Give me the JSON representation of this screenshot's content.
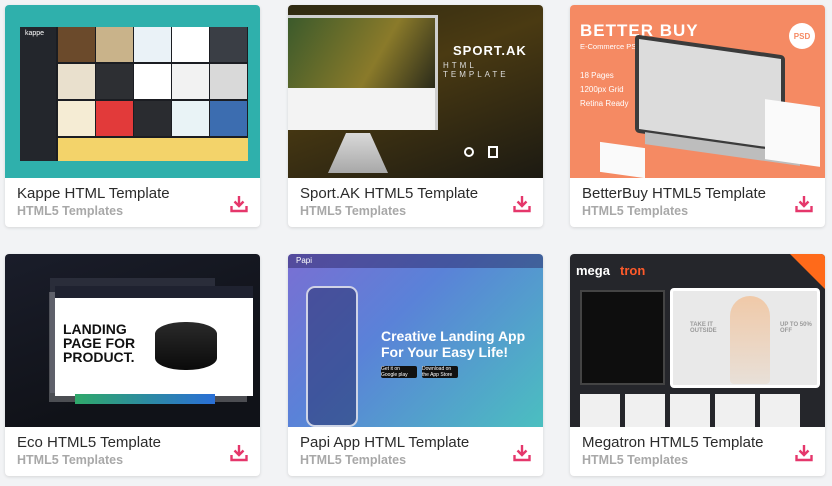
{
  "cards": [
    {
      "title": "Kappe HTML Template",
      "category": "HTML5 Templates",
      "thumb": {
        "brand": "kappe"
      }
    },
    {
      "title": "Sport.AK HTML5 Template",
      "category": "HTML5 Templates",
      "thumb": {
        "brand": "SPORT.AK",
        "subtitle": "HTML TEMPLATE"
      }
    },
    {
      "title": "BetterBuy HTML5 Template",
      "category": "HTML5 Templates",
      "thumb": {
        "brand": "BETTER BUY",
        "subtitle": "E-Commerce PSD UI Kit",
        "features": [
          "18 Pages",
          "1200px Grid",
          "Retina Ready"
        ],
        "badge": "PSD"
      }
    },
    {
      "title": "Eco HTML5 Template",
      "category": "HTML5 Templates",
      "thumb": {
        "headline": "LANDING PAGE FOR PRODUCT."
      }
    },
    {
      "title": "Papi App HTML Template",
      "category": "HTML5 Templates",
      "thumb": {
        "brand": "Papi",
        "headline": "Creative Landing App For Your Easy Life!",
        "buttons": [
          "Get it on Google play",
          "Download on the App Store"
        ]
      }
    },
    {
      "title": "Megatron HTML5 Template",
      "category": "HTML5 Templates",
      "thumb": {
        "brand_part1": "mega",
        "brand_part2": "tron",
        "promo": "TAKE IT OUTSIDE",
        "promo2": "UP TO 50% OFF"
      }
    }
  ],
  "colors": {
    "download_icon": "#e5376b",
    "title_text": "#2b2b2b",
    "category_text": "#a8a8a8",
    "background": "#f2f3f5"
  },
  "icons": {
    "download": "download-icon"
  }
}
